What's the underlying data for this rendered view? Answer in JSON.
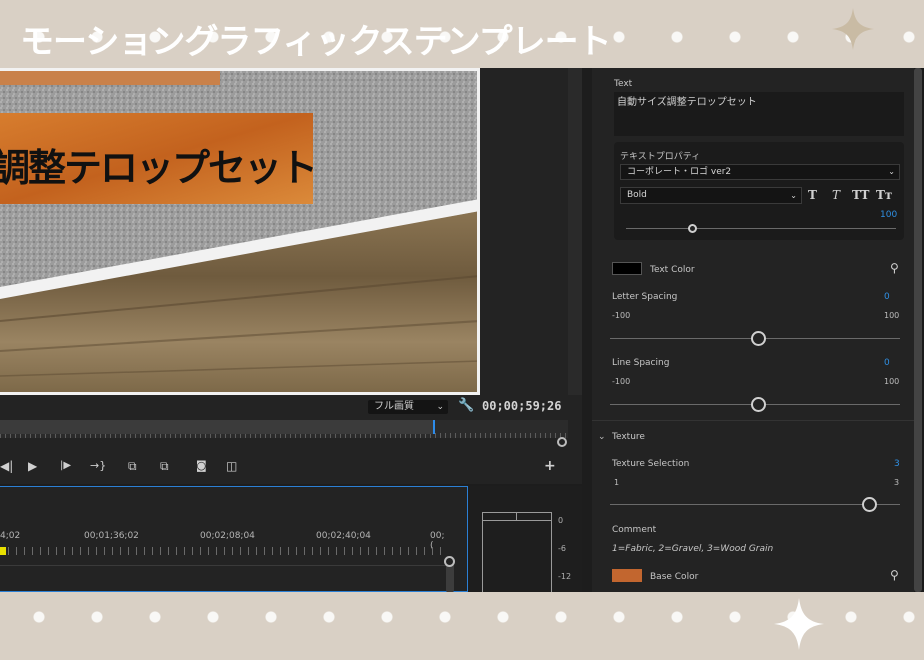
{
  "banner": {
    "title": "モーショングラフィックステンプレート"
  },
  "monitor": {
    "preview_caption": "調整テロップセット",
    "quality": "フル画質",
    "timecode": "00;00;59;26"
  },
  "timeline": {
    "times": [
      "4;02",
      "00;01;36;02",
      "00;02;08;04",
      "00;02;40;04",
      "00;("
    ]
  },
  "meter": {
    "labels": [
      "0",
      "-6",
      "-12"
    ]
  },
  "panel": {
    "text_label": "Text",
    "text_value": "自動サイズ調整テロップセット",
    "text_props_label": "テキストプロパティ",
    "font_name": "コーポレート・ロゴ ver2",
    "font_weight": "Bold",
    "font_size": "100",
    "style_buttons": [
      "T",
      "T",
      "TT",
      "Tт"
    ],
    "text_color_label": "Text Color",
    "text_color": "#000000",
    "letter_spacing": {
      "label": "Letter Spacing",
      "value": "0",
      "min": "-100",
      "max": "100"
    },
    "line_spacing": {
      "label": "Line Spacing",
      "value": "0",
      "min": "-100",
      "max": "100"
    },
    "texture_section": "Texture",
    "texture_selection": {
      "label": "Texture Selection",
      "value": "3",
      "min": "1",
      "max": "3"
    },
    "comment_label": "Comment",
    "comment_text": "1=Fabric, 2=Gravel, 3=Wood Grain",
    "base_color_label": "Base Color",
    "base_color": "#c2662f"
  }
}
